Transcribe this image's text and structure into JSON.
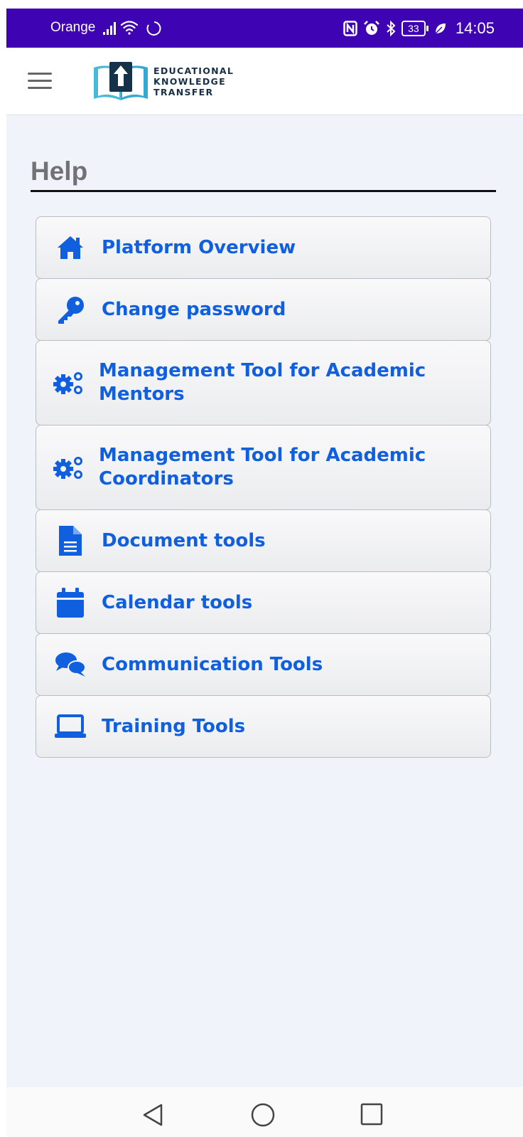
{
  "status_bar": {
    "carrier": "Orange",
    "battery": "33",
    "time": "14:05",
    "icons": [
      "signal-icon",
      "wifi-icon",
      "sync-icon",
      "nfc-icon",
      "alarm-icon",
      "bluetooth-icon",
      "battery-icon",
      "leaf-icon"
    ]
  },
  "header": {
    "menu_icon": "hamburger-icon",
    "logo_lines": [
      "EDUCATIONAL",
      "KNOWLEDGE",
      "TRANSFER"
    ]
  },
  "page": {
    "title": "Help"
  },
  "menu": {
    "items": [
      {
        "label": "Platform Overview",
        "icon": "home-icon"
      },
      {
        "label": "Change password",
        "icon": "key-icon"
      },
      {
        "label": "Management Tool for Academic Mentors",
        "icon": "cogs-icon"
      },
      {
        "label": "Management Tool for Academic Coordinators",
        "icon": "cogs-icon"
      },
      {
        "label": "Document tools",
        "icon": "document-icon"
      },
      {
        "label": "Calendar tools",
        "icon": "calendar-icon"
      },
      {
        "label": "Communication Tools",
        "icon": "comments-icon"
      },
      {
        "label": "Training Tools",
        "icon": "laptop-icon"
      }
    ]
  },
  "nav_bar": {
    "buttons": [
      "back-icon",
      "home-circle-icon",
      "recents-icon"
    ]
  },
  "colors": {
    "status_bar": "#3e04b3",
    "accent": "#0f5fdf",
    "background": "#f0f4fa",
    "title": "#707276"
  }
}
